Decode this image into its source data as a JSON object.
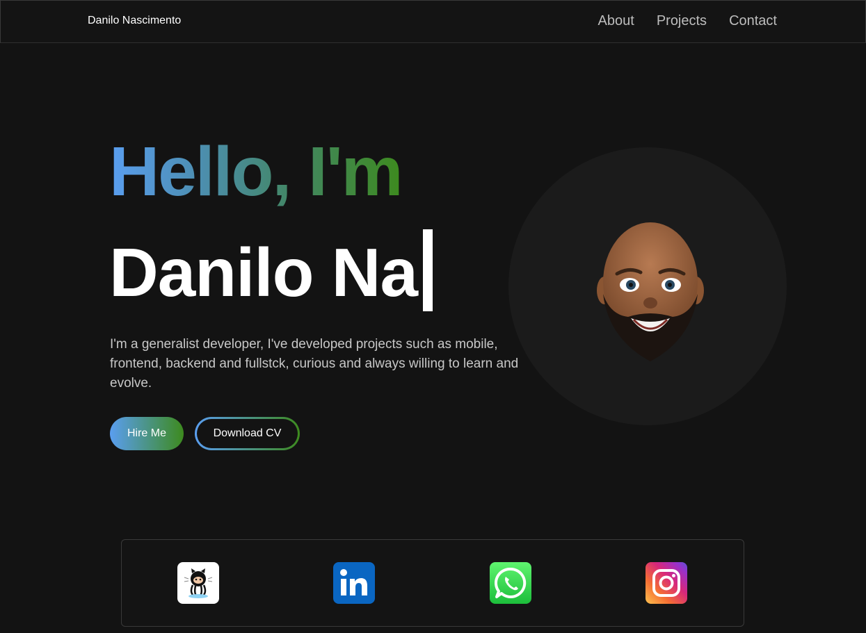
{
  "navbar": {
    "brand": "Danilo Nascimento",
    "links": [
      {
        "label": "About"
      },
      {
        "label": "Projects"
      },
      {
        "label": "Contact"
      }
    ]
  },
  "hero": {
    "greeting": "Hello, I'm",
    "typed_name": "Danilo Na",
    "bio": "I'm a generalist developer, I've developed projects such as mobile, frontend, backend and fullstck, curious and always willing to learn and evolve.",
    "buttons": {
      "hire": "Hire Me",
      "download_cv": "Download CV"
    },
    "avatar_icon": "memoji-avatar"
  },
  "social": [
    {
      "icon": "github-icon"
    },
    {
      "icon": "linkedin-icon"
    },
    {
      "icon": "whatsapp-icon"
    },
    {
      "icon": "instagram-icon"
    }
  ],
  "colors": {
    "background": "#131313",
    "gradient_start": "#5a9ef0",
    "gradient_end": "#3d8a1e",
    "text_muted": "#c8c8c8"
  }
}
